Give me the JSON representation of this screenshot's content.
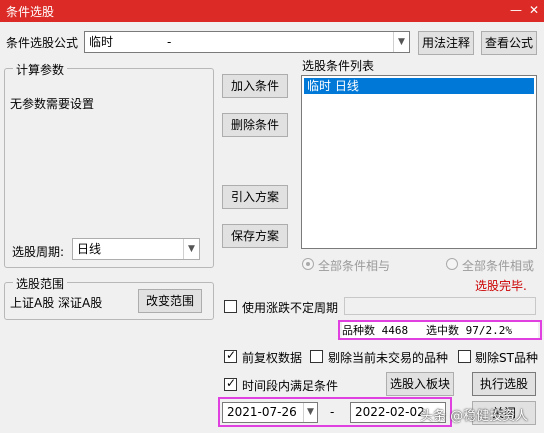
{
  "window": {
    "title": "条件选股",
    "minimize_glyph": "—",
    "close_glyph": "✕"
  },
  "formula": {
    "label": "条件选股公式",
    "value": "临时",
    "dash": "-",
    "usage_button": "用法注释",
    "view_button": "查看公式"
  },
  "params": {
    "title": "计算参数",
    "no_params": "无参数需要设置",
    "period_label": "选股周期:",
    "period_value": "日线"
  },
  "condition_buttons": {
    "add": "加入条件",
    "delete": "删除条件",
    "import": "引入方案",
    "save": "保存方案"
  },
  "condition_list": {
    "title": "选股条件列表",
    "items": [
      {
        "label": "临时   日线"
      }
    ]
  },
  "logic": {
    "all_and": "全部条件相与",
    "all_or": "全部条件相或"
  },
  "status": {
    "text": "选股完毕.",
    "color": "#cc0000"
  },
  "scope": {
    "title": "选股范围",
    "markets": "上证A股  深证A股",
    "change_button": "改变范围"
  },
  "options": {
    "use_rise_fall": "使用涨跌不定周期",
    "forward_adjust": "前复权数据",
    "exclude_untraded": "剔除当前未交易的品种",
    "exclude_st": "剔除ST品种",
    "period_satisfy": "时间段内满足条件"
  },
  "counts": {
    "total_text": "品种数 4468",
    "selected_text": "选中数 97/2.2%"
  },
  "actions": {
    "to_block": "选股入板块",
    "execute": "执行选股",
    "close_partial": "关闭"
  },
  "dates": {
    "start": "2021-07-26",
    "separator": "-",
    "end": "2022-02-02"
  },
  "watermark": "头条 @稳健投资人",
  "colors": {
    "title_bar": "#dc2b26",
    "highlight_box": "#e040e0",
    "selection": "#0078d7"
  }
}
